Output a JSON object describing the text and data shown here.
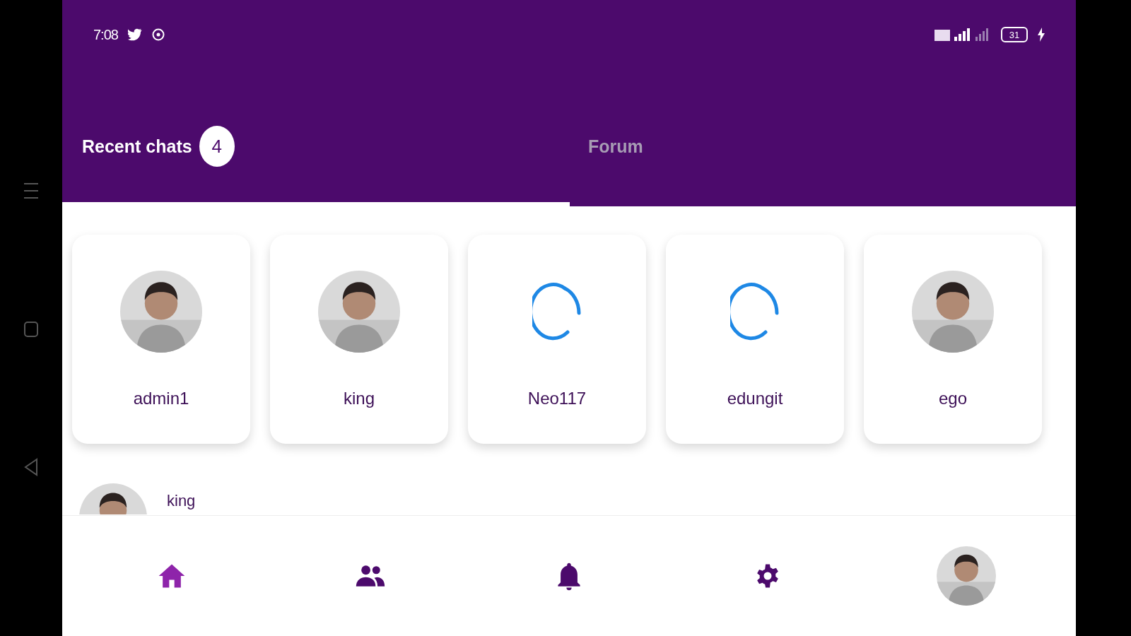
{
  "status_bar": {
    "time": "7:08",
    "battery": "31"
  },
  "tabs": [
    {
      "label": "Recent chats",
      "badge": "4",
      "selected": true
    },
    {
      "label": "Forum",
      "selected": false
    }
  ],
  "contacts": [
    {
      "name": "admin1",
      "kind": "picture"
    },
    {
      "name": "king",
      "kind": "picture"
    },
    {
      "name": "Neo117",
      "kind": "loading"
    },
    {
      "name": "edungit",
      "kind": "loading"
    },
    {
      "name": "ego",
      "kind": "picture"
    }
  ],
  "recent_chats": [
    {
      "name": "king",
      "kind": "picture"
    }
  ],
  "bottom_nav": [
    {
      "kind": "home",
      "selected": true
    },
    {
      "kind": "people",
      "selected": false
    },
    {
      "kind": "bell",
      "selected": false
    },
    {
      "kind": "settings",
      "selected": false
    },
    {
      "kind": "profile",
      "selected": false
    }
  ]
}
